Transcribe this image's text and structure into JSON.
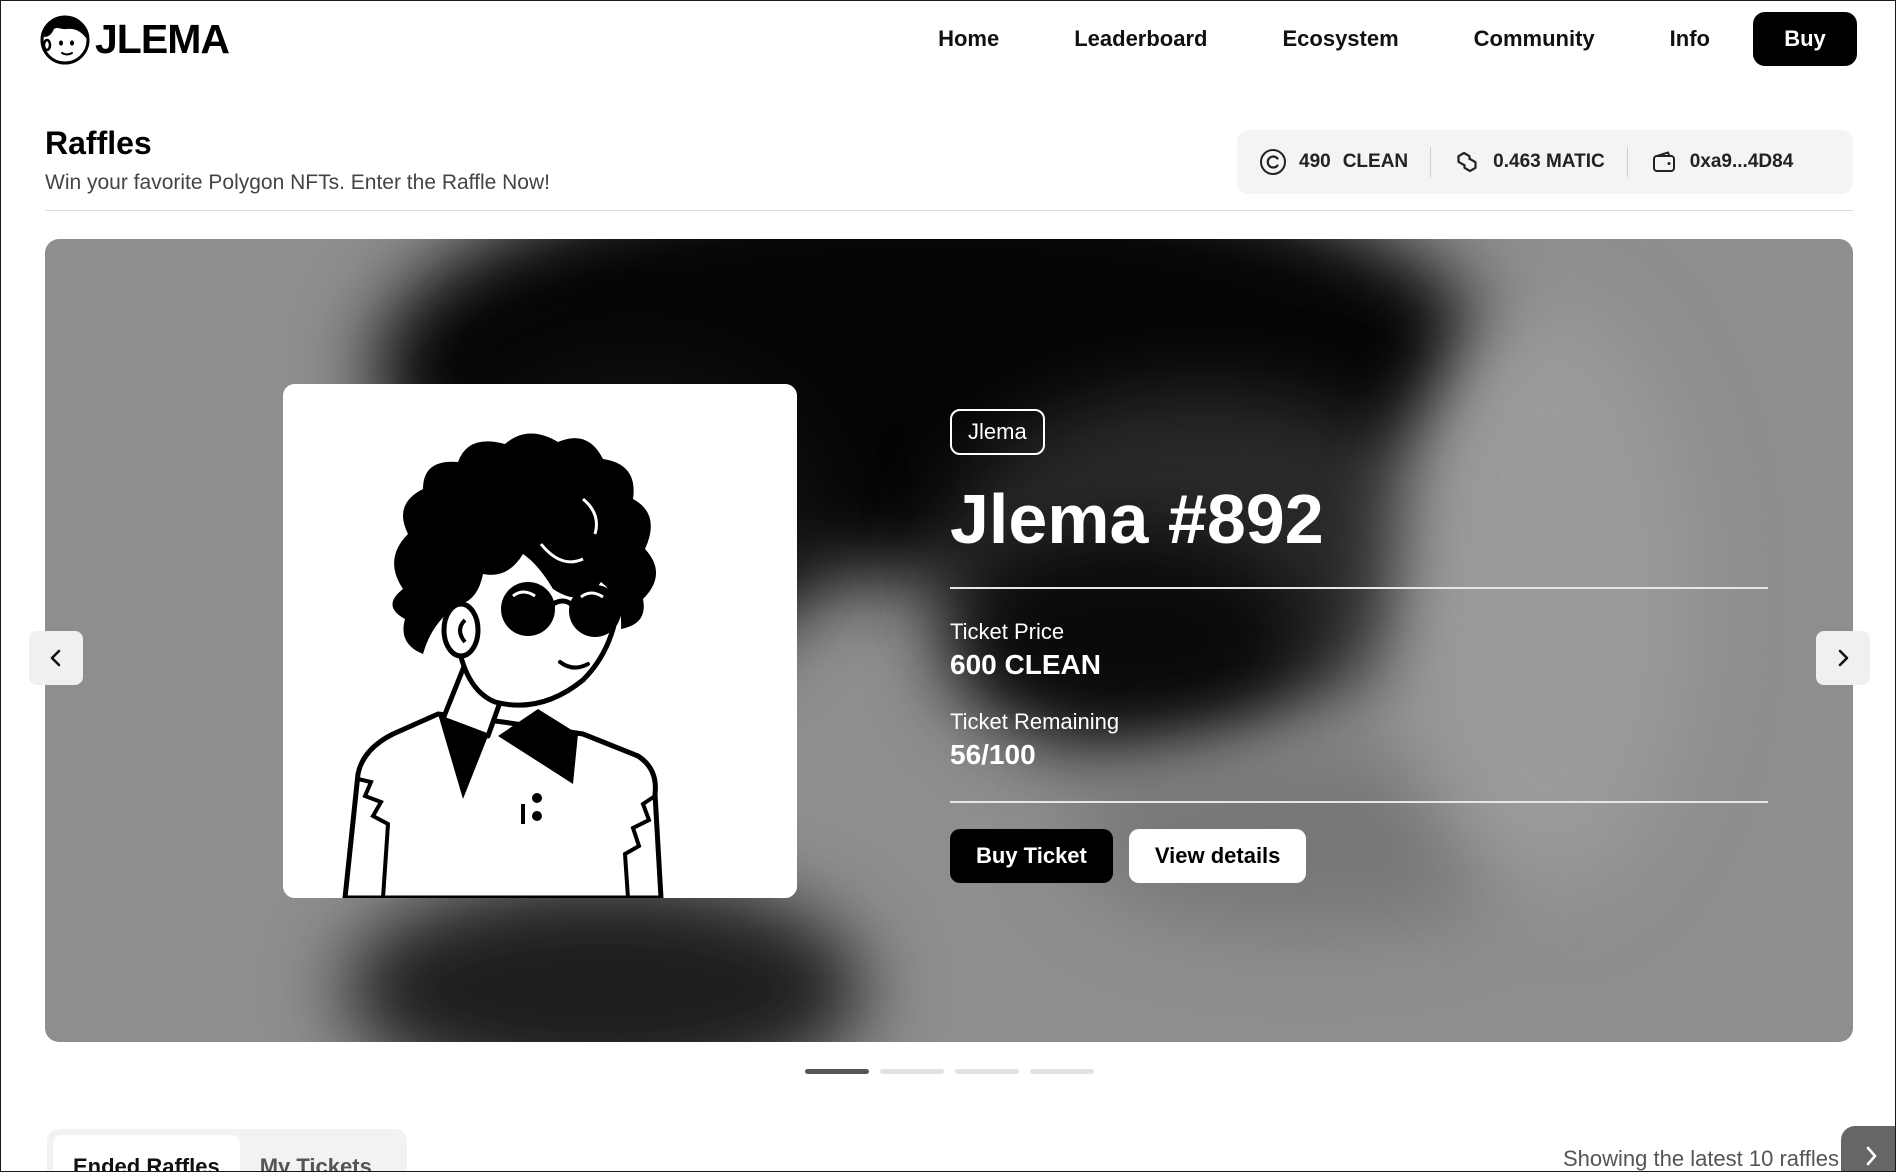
{
  "brand": {
    "name": "JLEMA"
  },
  "nav": {
    "items": [
      "Home",
      "Leaderboard",
      "Ecosystem",
      "Community",
      "Info"
    ],
    "buy_label": "Buy"
  },
  "page": {
    "title": "Raffles",
    "subtitle": "Win your favorite Polygon NFTs. Enter the Raffle Now!"
  },
  "wallet": {
    "clean_amount": "490",
    "clean_unit": "CLEAN",
    "matic": "0.463 MATIC",
    "address": "0xa9...4D84"
  },
  "raffle": {
    "collection": "Jlema",
    "title": "Jlema #892",
    "ticket_price_label": "Ticket Price",
    "ticket_price": "600 CLEAN",
    "ticket_remaining_label": "Ticket Remaining",
    "ticket_remaining": "56/100",
    "buy_ticket_label": "Buy Ticket",
    "view_details_label": "View details"
  },
  "carousel": {
    "slide_count": 4,
    "active_index": 0
  },
  "tabs": {
    "items": [
      "Ended Raffles",
      "My Tickets"
    ],
    "active": 0
  },
  "list_info": "Showing the latest 10 raffles",
  "icons": {
    "logo": "jlema-face-icon",
    "clean": "copyright-coin-icon",
    "matic": "polygon-link-icon",
    "wallet": "wallet-icon",
    "prev": "chevron-left-icon",
    "next": "chevron-right-icon"
  },
  "colors": {
    "primary": "#000000",
    "hero_bg": "#8e8e8e",
    "accent_text": "#ffffff"
  }
}
